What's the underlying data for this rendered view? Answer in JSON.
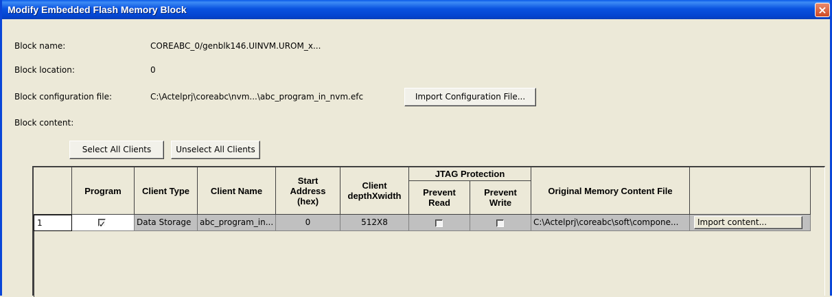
{
  "window": {
    "title": "Modify Embedded Flash Memory Block",
    "close_glyph": "×"
  },
  "block": {
    "name_label": "Block name:",
    "name_value": "COREABC_0/genblk146.UINVM.UROM_x...",
    "location_label": "Block location:",
    "location_value": "0",
    "config_label": "Block configuration file:",
    "config_value": "C:\\Actelprj\\coreabc\\nvm...\\abc_program_in_nvm.efc",
    "import_config_button": "Import Configuration File...",
    "content_label": "Block content:"
  },
  "buttons": {
    "select_all": "Select All Clients",
    "unselect_all": "Unselect All Clients"
  },
  "table": {
    "headers": {
      "program": "Program",
      "client_type": "Client Type",
      "client_name": "Client Name",
      "start_address": "Start Address (hex)",
      "depth_width": "Client depthXwidth",
      "jtag_protection": "JTAG Protection",
      "prevent_read": "Prevent Read",
      "prevent_write": "Prevent Write",
      "original_file": "Original Memory Content File"
    },
    "rows": [
      {
        "index": "1",
        "program": true,
        "client_type": "Data Storage",
        "client_name": "abc_program_in...",
        "start_address": "0",
        "depth_width": "512X8",
        "prevent_read": false,
        "prevent_write": false,
        "original_file": "C:\\Actelprj\\coreabc\\soft\\compone...",
        "import_button": "Import content..."
      }
    ]
  }
}
